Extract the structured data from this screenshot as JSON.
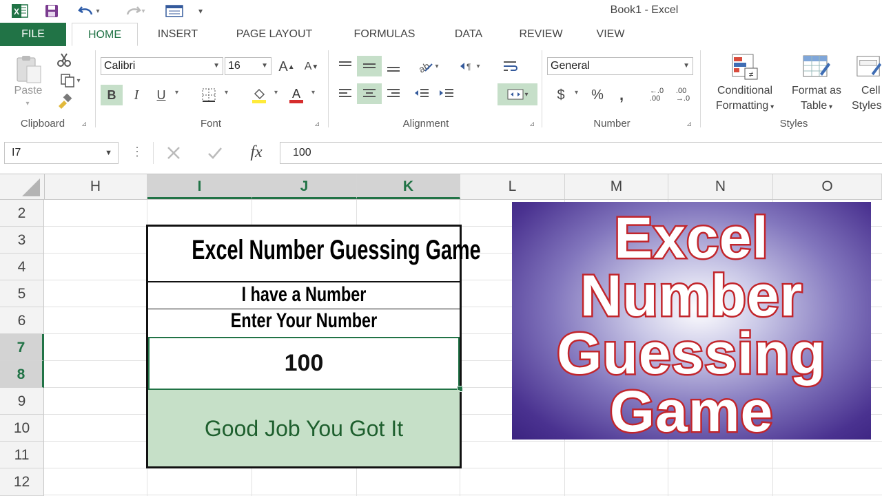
{
  "window": {
    "title": "Book1 - Excel"
  },
  "quick_access": {
    "app_icon": "excel-logo",
    "save_icon": "floppy-disk-icon",
    "undo_icon": "undo-arrow-icon",
    "redo_icon": "redo-arrow-icon"
  },
  "tabs": [
    "FILE",
    "HOME",
    "INSERT",
    "PAGE LAYOUT",
    "FORMULAS",
    "DATA",
    "REVIEW",
    "VIEW"
  ],
  "active_tab": "HOME",
  "ribbon": {
    "clipboard": {
      "label": "Clipboard",
      "paste": "Paste"
    },
    "font": {
      "label": "Font",
      "font_name": "Calibri",
      "font_size": "16",
      "bold": "B",
      "italic": "I",
      "underline": "U",
      "grow": "A",
      "shrink": "A"
    },
    "alignment": {
      "label": "Alignment"
    },
    "number": {
      "label": "Number",
      "format": "General",
      "currency": "$",
      "percent": "%",
      "comma": ",",
      "inc_decimal": "←.0\n.00",
      "dec_decimal": ".00\n→.0"
    },
    "styles": {
      "label": "Styles",
      "conditional": [
        "Conditional",
        "Formatting"
      ],
      "format_table": [
        "Format as",
        "Table"
      ],
      "cell_styles": [
        "Cell",
        "Styles"
      ]
    }
  },
  "formula_bar": {
    "name_box": "I7",
    "fx": "fx",
    "value": "100"
  },
  "grid": {
    "columns": [
      "H",
      "I",
      "J",
      "K",
      "L",
      "M",
      "N",
      "O"
    ],
    "rows": [
      "2",
      "3",
      "4",
      "5",
      "6",
      "7",
      "8",
      "9",
      "10",
      "11",
      "12"
    ],
    "selected_columns": [
      "I",
      "J",
      "K"
    ],
    "selected_rows": [
      "7",
      "8"
    ]
  },
  "game": {
    "title": "Excel Number Guessing Game",
    "line1": "I have a Number",
    "line2": "Enter Your Number",
    "entry_value": "100",
    "result": "Good Job You Got It"
  },
  "banner": {
    "words": [
      "Excel",
      "Number",
      "Guessing",
      "Game"
    ]
  },
  "colors": {
    "excel_green": "#217346",
    "result_fill": "#c6e0c8",
    "banner_outline": "#c2252b"
  }
}
